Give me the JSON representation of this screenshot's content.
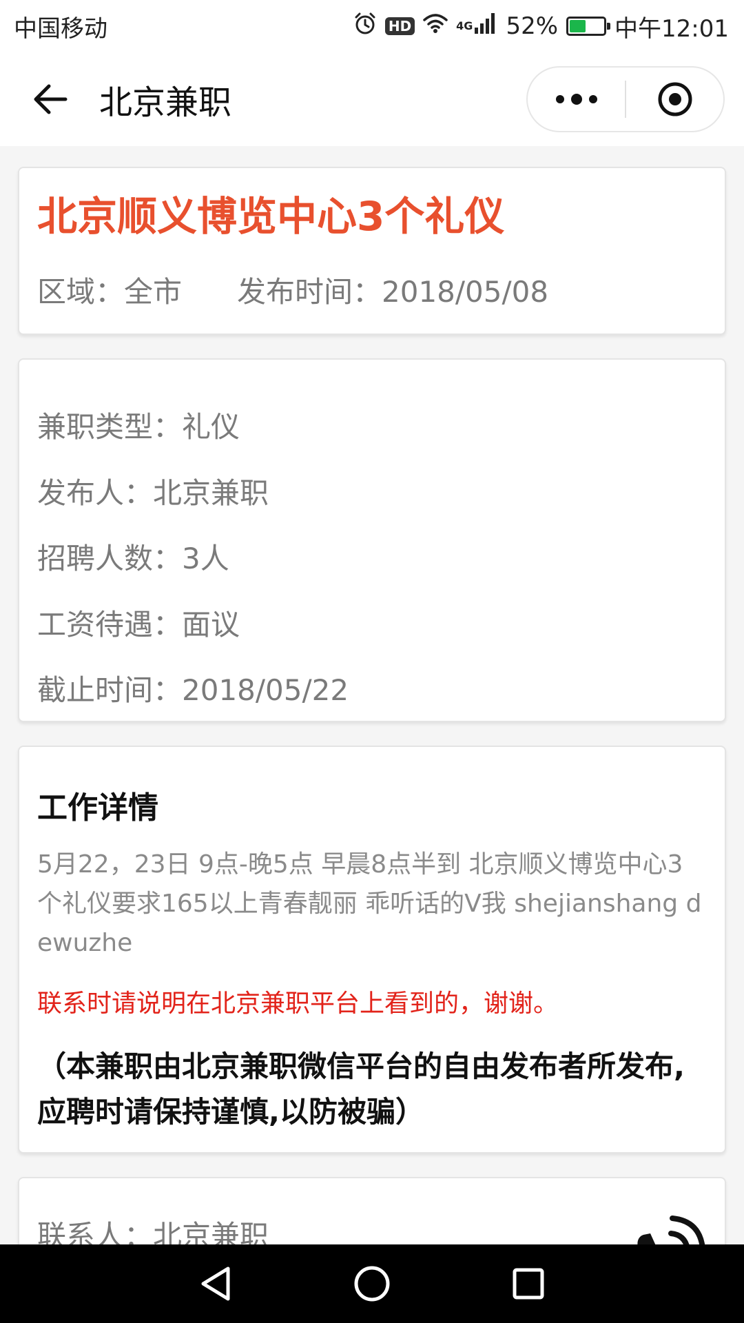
{
  "status_bar": {
    "carrier": "中国移动",
    "network": "4G",
    "battery_percent": "52%",
    "battery_level": 0.52,
    "time": "中午12:01",
    "icons": [
      "alarm-icon",
      "hd-icon",
      "wifi-icon",
      "signal-icon",
      "battery-icon"
    ]
  },
  "nav": {
    "title": "北京兼职",
    "icons": [
      "back-arrow-icon",
      "more-dots-icon",
      "target-icon"
    ]
  },
  "job": {
    "title": "北京顺义博览中心3个礼仪",
    "region": "区域：全市",
    "publish_date": "发布时间：2018/05/08",
    "title_color": "#e8502e"
  },
  "info": {
    "type": "兼职类型：礼仪",
    "publisher": "发布人：北京兼职",
    "headcount": "招聘人数：3人",
    "salary": "工资待遇：面议",
    "deadline": "截止时间：2018/05/22"
  },
  "details": {
    "section_title": "工作详情",
    "text": "5月22，23日 9点-晚5点 早晨8点半到 北京顺义博览中心3个礼仪要求165以上青春靓丽 乖听话的V我 shejianshang dewuzhe",
    "contact_note": "联系时请说明在北京兼职平台上看到的，谢谢。",
    "disclaimer": "（本兼职由北京兼职微信平台的自由发布者所发布,应聘时请保持谨慎,以防被骗）",
    "note_color": "#e2231a"
  },
  "contact": {
    "person": "联系人：北京兼职",
    "icon": "phone-call-icon"
  },
  "system_nav": {
    "icons": [
      "back-triangle-icon",
      "home-circle-icon",
      "recents-square-icon"
    ]
  }
}
